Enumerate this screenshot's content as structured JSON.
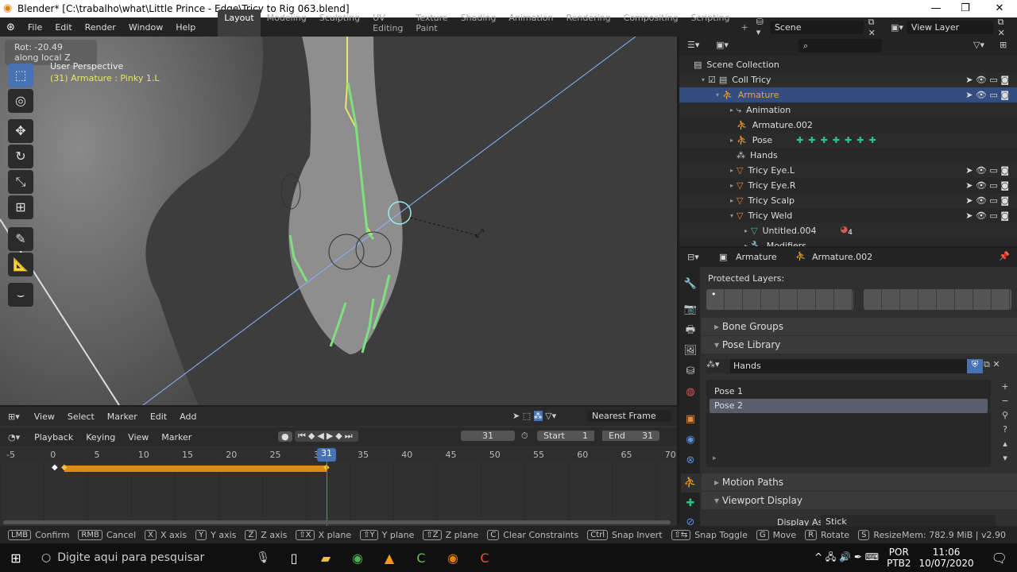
{
  "window": {
    "title": "Blender* [C:\\trabalho\\what\\Little Prince - Edge\\Tricy to Rig 063.blend]",
    "min": "—",
    "max": "❐",
    "close": "✕"
  },
  "menus": [
    "File",
    "Edit",
    "Render",
    "Window",
    "Help"
  ],
  "workspaces": [
    "Layout",
    "Modeling",
    "Sculpting",
    "UV Editing",
    "Texture Paint",
    "Shading",
    "Animation",
    "Rendering",
    "Compositing",
    "Scripting"
  ],
  "scene": "Scene",
  "view_layer": "View Layer",
  "viewport": {
    "operator": "Rot: -20.49 along local Z",
    "view_name": "User Perspective",
    "object_info": "(31) Armature : Pinky 1.L"
  },
  "outliner": {
    "rows": [
      {
        "label": "Scene Collection",
        "indent": 1
      },
      {
        "label": "Coll Tricy",
        "indent": 2,
        "vis": true
      },
      {
        "label": "Armature",
        "indent": 3,
        "vis": true,
        "selected": true
      },
      {
        "label": "Animation",
        "indent": 4
      },
      {
        "label": "Armature.002",
        "indent": 4
      },
      {
        "label": "Pose",
        "indent": 4
      },
      {
        "label": "Hands",
        "indent": 4
      },
      {
        "label": "Tricy Eye.L",
        "indent": 4,
        "vis": true
      },
      {
        "label": "Tricy Eye.R",
        "indent": 4,
        "vis": true
      },
      {
        "label": "Tricy Scalp",
        "indent": 4,
        "vis": true
      },
      {
        "label": "Tricy Weld",
        "indent": 4,
        "vis": true
      },
      {
        "label": "Untitled.004",
        "indent": 5
      },
      {
        "label": "Modifiers",
        "indent": 5
      }
    ],
    "material_count": "4"
  },
  "properties": {
    "object": "Armature",
    "data": "Armature.002",
    "protected_layers": "Protected Layers:",
    "bone_groups": "Bone Groups",
    "pose_library": "Pose Library",
    "library_name": "Hands",
    "poses": [
      "Pose 1",
      "Pose 2"
    ],
    "active_pose": 1,
    "motion_paths": "Motion Paths",
    "viewport_display": "Viewport Display",
    "display_as_label": "Display As",
    "display_as": "Stick"
  },
  "timeline": {
    "header1": [
      "View",
      "Select",
      "Marker",
      "Edit",
      "Add"
    ],
    "snap": "Nearest Frame",
    "header2": [
      "Playback",
      "Keying",
      "View",
      "Marker"
    ],
    "current_frame": "31",
    "start_label": "Start",
    "start": "1",
    "end_label": "End",
    "end": "31",
    "ticks": [
      "-5",
      "0",
      "5",
      "10",
      "15",
      "20",
      "25",
      "30",
      "35",
      "40",
      "45",
      "50",
      "55",
      "60",
      "65",
      "70"
    ]
  },
  "status": {
    "items": [
      [
        "LMB",
        "Confirm"
      ],
      [
        "RMB",
        "Cancel"
      ],
      [
        "X",
        "X axis"
      ],
      [
        "Y",
        "Y axis"
      ],
      [
        "Z",
        "Z axis"
      ],
      [
        "⇧X",
        "X plane"
      ],
      [
        "⇧Y",
        "Y plane"
      ],
      [
        "⇧Z",
        "Z plane"
      ],
      [
        "C",
        "Clear Constraints"
      ],
      [
        "Ctrl",
        "Snap Invert"
      ],
      [
        "⇧⇆",
        "Snap Toggle"
      ],
      [
        "G",
        "Move"
      ],
      [
        "R",
        "Rotate"
      ],
      [
        "S",
        "Resize"
      ]
    ],
    "mem": "Mem: 782.9 MiB | v2.90"
  },
  "taskbar": {
    "search": "Digite aqui para pesquisar",
    "lang1": "POR",
    "lang2": "PTB2",
    "time": "11:06",
    "date": "10/07/2020"
  },
  "colors": {
    "accent": "#4772b3",
    "bone": "#7ee07e",
    "keyframe_bar": "#e08a10"
  }
}
